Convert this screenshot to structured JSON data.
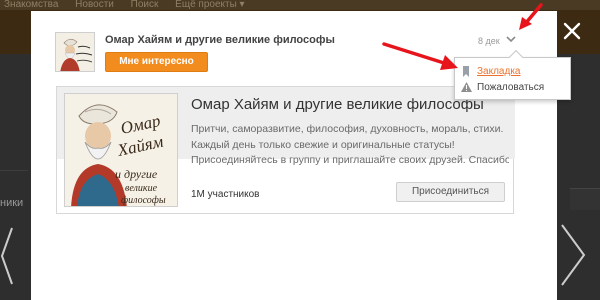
{
  "background": {
    "nav_items": [
      "Знакомства",
      "Новости",
      "Поиск",
      "Ещё проекты ▾"
    ],
    "left_text": "ники"
  },
  "post": {
    "title": "Омар Хайям и другие великие философы",
    "interest_button": "Мне интересно",
    "date": "8 дек"
  },
  "group_card": {
    "title": "Омар Хайям и другие великие философы",
    "description_lines": [
      "Притчи, саморазвитие, философия, духовность, мораль, стихи.",
      "Каждый день только свежие и оригинальные статусы!",
      "Присоединяйтесь в группу и приглашайте своих друзей. Спасибо,"
    ],
    "members": "1М участников",
    "join_button": "Присоединиться",
    "logo_text": {
      "line1": "Омар",
      "line2": "Хайям",
      "line3": "и другие",
      "line4": "великие",
      "line5": "философы"
    }
  },
  "dropdown": {
    "items": [
      {
        "label": "Закладка",
        "icon": "bookmark-icon"
      },
      {
        "label": "Пожаловаться",
        "icon": "warning-icon"
      }
    ]
  },
  "colors": {
    "accent_orange": "#f28c1e",
    "link_orange": "#eb722e",
    "annotation_red": "#e8141c",
    "overlay_dark": "#2e2e2e"
  }
}
